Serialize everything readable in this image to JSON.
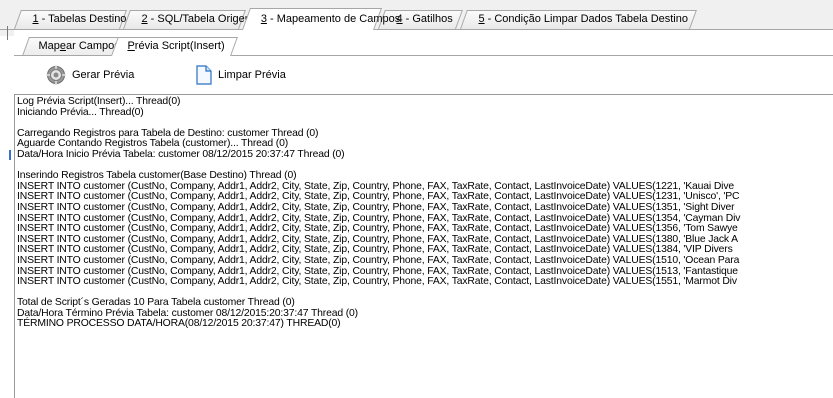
{
  "tabs": [
    {
      "key": "1",
      "label": " - Tabelas Destino"
    },
    {
      "key": "2",
      "label": " - SQL/Tabela Origem"
    },
    {
      "key": "3",
      "label": " - Mapeamento de Campos"
    },
    {
      "key": "4",
      "label": " - Gatilhos"
    },
    {
      "key": "5",
      "label": " - Condição Limpar Dados Tabela Destino"
    }
  ],
  "subtabs": [
    {
      "pre": "Map",
      "key": "e",
      "post": "ar Campos"
    },
    {
      "pre": "",
      "key": "P",
      "post": "révia Script(Insert)"
    }
  ],
  "toolbar": {
    "gerar_label": "Gerar Prévia",
    "limpar_label": "Limpar Prévia"
  },
  "icons": {
    "gerar": "gear-icon",
    "limpar": "page-icon"
  },
  "log": {
    "header": [
      "Log Prévia Script(Insert)... Thread(0)",
      "Iniciando Prévia... Thread(0)"
    ],
    "loading": [
      "Carregando Registros para Tabela de Destino: customer Thread (0)",
      "Aguarde Contando Registros Tabela (customer)... Thread (0)",
      "Data/Hora Inicio Prévia Tabela: customer 08/12/2015 20:37:47 Thread (0)"
    ],
    "inserting": "Inserindo Registros Tabela customer(Base Destino) Thread (0)",
    "inserts": [
      "INSERT INTO customer (CustNo, Company, Addr1, Addr2, City, State, Zip, Country, Phone, FAX, TaxRate, Contact, LastInvoiceDate) VALUES(1221, 'Kauai Dive",
      "INSERT INTO customer (CustNo, Company, Addr1, Addr2, City, State, Zip, Country, Phone, FAX, TaxRate, Contact, LastInvoiceDate) VALUES(1231, 'Unisco', 'PC",
      "INSERT INTO customer (CustNo, Company, Addr1, Addr2, City, State, Zip, Country, Phone, FAX, TaxRate, Contact, LastInvoiceDate) VALUES(1351, 'Sight Diver",
      "INSERT INTO customer (CustNo, Company, Addr1, Addr2, City, State, Zip, Country, Phone, FAX, TaxRate, Contact, LastInvoiceDate) VALUES(1354, 'Cayman Div",
      "INSERT INTO customer (CustNo, Company, Addr1, Addr2, City, State, Zip, Country, Phone, FAX, TaxRate, Contact, LastInvoiceDate) VALUES(1356, 'Tom Sawye",
      "INSERT INTO customer (CustNo, Company, Addr1, Addr2, City, State, Zip, Country, Phone, FAX, TaxRate, Contact, LastInvoiceDate) VALUES(1380, 'Blue Jack A",
      "INSERT INTO customer (CustNo, Company, Addr1, Addr2, City, State, Zip, Country, Phone, FAX, TaxRate, Contact, LastInvoiceDate) VALUES(1384, 'VIP Divers",
      "INSERT INTO customer (CustNo, Company, Addr1, Addr2, City, State, Zip, Country, Phone, FAX, TaxRate, Contact, LastInvoiceDate) VALUES(1510, 'Ocean Para",
      "INSERT INTO customer (CustNo, Company, Addr1, Addr2, City, State, Zip, Country, Phone, FAX, TaxRate, Contact, LastInvoiceDate) VALUES(1513, 'Fantastique",
      "INSERT INTO customer (CustNo, Company, Addr1, Addr2, City, State, Zip, Country, Phone, FAX, TaxRate, Contact, LastInvoiceDate) VALUES(1551, 'Marmot Div"
    ],
    "footer": [
      "Total de Script´s Geradas 10 Para Tabela customer Thread (0)",
      "Data/Hora Término Prévia Tabela: customer 08/12/2015:20:37:47 Thread (0)",
      "TÉRMINO PROCESSO DATA/HORA(08/12/2015 20:37:47) THREAD(0)"
    ]
  }
}
